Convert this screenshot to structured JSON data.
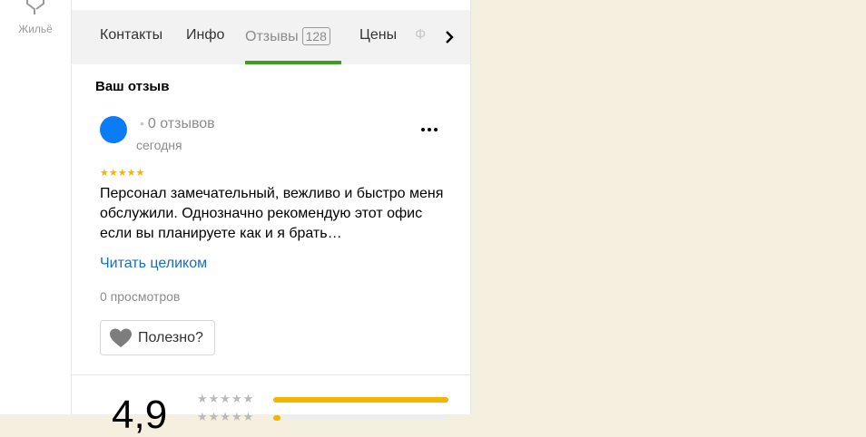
{
  "rail": {
    "label": "Жильё",
    "icon": "housing-icon"
  },
  "tabs": [
    {
      "label": "Контакты"
    },
    {
      "label": "Инфо"
    },
    {
      "label": "Отзывы",
      "badge": "128",
      "active": true
    },
    {
      "label": "Цены"
    },
    {
      "label": "Ф"
    }
  ],
  "review_section": {
    "title": "Ваш отзыв",
    "author_reviews": "0 отзывов",
    "date": "сегодня",
    "stars": "★★★★★",
    "text": "Персонал замечательный, вежливо и быстро меня обслужили. Однозначно рекомендую этот офис если вы планируете как и я брать…",
    "read_more": "Читать целиком",
    "views": "0 просмотров",
    "useful_label": "Полезно?"
  },
  "rating_summary": {
    "value": "4,9",
    "rows": [
      {
        "stars": "★★★★★",
        "fraction": 1.0
      },
      {
        "stars": "★★★★★",
        "fraction": 0.04
      }
    ]
  },
  "colors": {
    "accent_green": "#3d9c22",
    "link_blue": "#196dbe",
    "avatar_blue": "#0a7cf5",
    "star_yellow": "#f5b400",
    "map_bg": "#f5efe0"
  }
}
